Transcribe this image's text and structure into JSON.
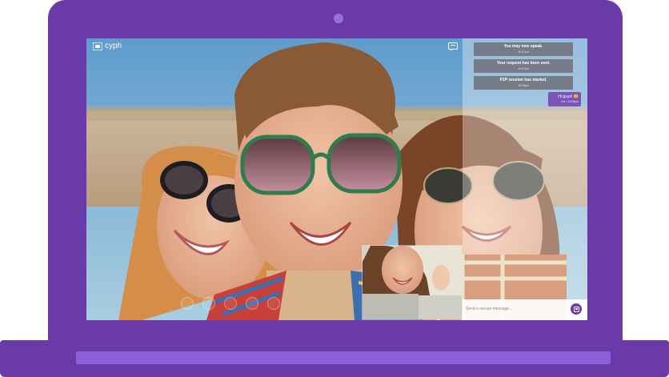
{
  "app": {
    "brand_name": "cyph"
  },
  "chat": {
    "system_messages": [
      {
        "text": "You may now speak.",
        "time": "10:07pm"
      },
      {
        "text": "Your request has been sent.",
        "time": "10:07pm"
      },
      {
        "text": "P2P session has started.",
        "time": "10:08pm"
      }
    ],
    "user_message": {
      "text": "Hi guys! 😉",
      "meta": "me • 10:08pm"
    },
    "composer_placeholder": "Send a secure message..."
  },
  "icons": {
    "brand": "cyph-logo-icon",
    "chat_toggle": "chat-bubble-icon",
    "send": "send-icon",
    "controls": [
      "mic-icon",
      "video-icon",
      "screen-icon",
      "end-call-icon",
      "more-icon"
    ]
  },
  "colors": {
    "frame": "#6a3aa8",
    "frame_light": "#8c5fd6",
    "accent": "#7a54b8",
    "system_bubble": "#6e6e78"
  }
}
